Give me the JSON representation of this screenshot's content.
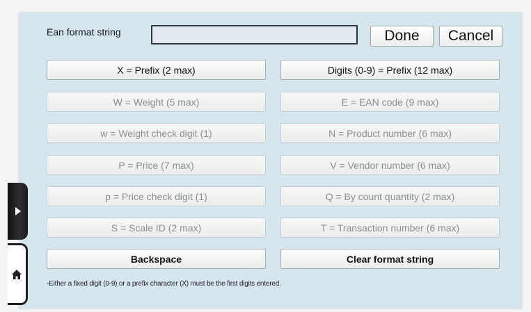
{
  "header": {
    "label": "Ean format string",
    "input_value": "",
    "done_label": "Done",
    "cancel_label": "Cancel"
  },
  "buttons": {
    "left": [
      {
        "label": "X = Prefix (2 max)",
        "state": "active"
      },
      {
        "label": "W = Weight (5 max)",
        "state": "disabled"
      },
      {
        "label": "w = Weight check digit (1)",
        "state": "disabled"
      },
      {
        "label": "P = Price (7 max)",
        "state": "disabled"
      },
      {
        "label": "p = Price check digit (1)",
        "state": "disabled"
      },
      {
        "label": "S = Scale ID (2 max)",
        "state": "disabled"
      },
      {
        "label": "Backspace",
        "state": "active"
      }
    ],
    "right": [
      {
        "label": "Digits (0-9) = Prefix (12 max)",
        "state": "active"
      },
      {
        "label": "E = EAN code (9 max)",
        "state": "disabled"
      },
      {
        "label": "N = Product number (6 max)",
        "state": "disabled"
      },
      {
        "label": "V = Vendor number (6 max)",
        "state": "disabled"
      },
      {
        "label": "Q = By count quantity (2 max)",
        "state": "disabled"
      },
      {
        "label": "T = Transaction number (6 max)",
        "state": "disabled"
      },
      {
        "label": "Clear format string",
        "state": "active"
      }
    ]
  },
  "footer": {
    "note": "-Either a fixed digit (0-9) or a prefix character (X) must be the first digits entered."
  },
  "side_nav": {
    "expand_icon": "triangle-right-icon",
    "home_icon": "home-icon"
  },
  "colors": {
    "panel_bg": "#d6e6ef",
    "page_bg": "#f3f4f4",
    "disabled_text": "#8a8f92"
  }
}
